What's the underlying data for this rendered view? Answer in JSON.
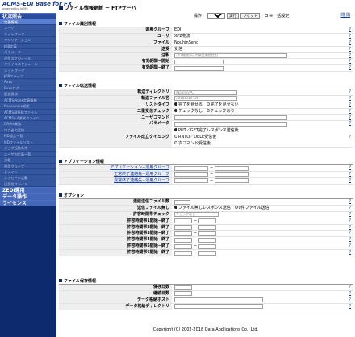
{
  "sidebar": {
    "logo_title": "ACMS-EDI Base for FX",
    "logo_sub": "powered by ACMS",
    "sections": [
      {
        "label": "状況照会",
        "items": [
          "定義情報",
          "ユーザ",
          "ネットワーク",
          "アプリケーション",
          "JOB定義",
          "パラメータ",
          "送信スケジュール",
          "ファイルスケジュール",
          "ネットワーク",
          "JOBステップ",
          "Rxxx",
          "Rxxxログ",
          "配信業務",
          "ACMS/Apex定義情報",
          "Naxxxxxxx設定",
          "ACMS/B業務ファイル",
          "ACMS/LA業務ファイル",
          "DR/Ax業務",
          "ログ出力変換",
          "MD設定一覧",
          "MDファイルリスト",
          "ジョブ起動条件",
          "ユーザ別定義一覧",
          "分類",
          "運用グループ",
          "ドメイン",
          "メッセージ定義",
          "送受信ファイル"
        ]
      },
      {
        "label": "ZEDI運用",
        "items": []
      },
      {
        "label": "データ操作",
        "items": []
      },
      {
        "label": "ライセンス",
        "items": []
      }
    ]
  },
  "header": {
    "title": "ファイル情報更新 － FTPサーバ",
    "help": "閉 閉",
    "op_label": "操作：",
    "op_select": "",
    "exec_button": "実行",
    "reset_button": "リセット",
    "no_display_label": "※一括設定"
  },
  "file_id": {
    "heading": "ファイル識別情報",
    "rows": [
      {
        "label": "運用グループ",
        "value": "EDI"
      },
      {
        "label": "ユーザ",
        "value": "XYZ物流"
      },
      {
        "label": "ファイル",
        "value": "NouhinSend"
      },
      {
        "label": "送受",
        "value": "受信"
      },
      {
        "label": "注釈",
        "value": "XYZ物流からの納品書受信用"
      },
      {
        "label": "有効期間−開始",
        "value": ""
      },
      {
        "label": "有効期間−終了",
        "value": ""
      }
    ]
  },
  "transfer": {
    "heading": "ファイル転送情報",
    "dir_label": "転送ディレクトリ",
    "dir_value": "/Nouhin/PC",
    "name_label": "転送ファイル名",
    "name_value": "20181116.txt",
    "list_label": "リストタイプ",
    "list_opt1": "完了を見せる",
    "list_opt2": "完了を見せない",
    "dup_label": "二重受信チェック",
    "dup_opt1": "チェックなし",
    "dup_opt2": "チェックあり",
    "usercmd_label": "ユーザコマンド",
    "param_label": "パラメータ",
    "timing_label": "ファイル成立タイミング",
    "timing_opt1": "PUT／GET完了レスポンス送信後",
    "timing_opt2": "RNTO／DELE受信後",
    "timing_opt3": "次コマンド受信後"
  },
  "app": {
    "heading": "アプリケーション情報",
    "rows": [
      {
        "label": "アプリケーション−運用グループ"
      },
      {
        "label": "正常終了連絡先−運用グループ"
      },
      {
        "label": "異常終了連絡先−運用グループ"
      }
    ]
  },
  "option": {
    "heading": "オプション",
    "count_label": "連結送信ファイル数",
    "send_label": "送信ファイル無し",
    "send_opt1": "ファイル無しレスポンス送信",
    "send_opt2": "0件ファイル送信",
    "check_label": "許容時間帯チェック",
    "check_value": "チェックなし",
    "time_rows": [
      "許容時間帯1開始−終了",
      "許容時間帯2開始−終了",
      "許容時間帯3開始−終了",
      "許容時間帯4開始−終了",
      "許容時間帯5開始−終了",
      "許容時間帯6開始−終了"
    ]
  },
  "storage": {
    "heading": "ファイル保存情報",
    "rows": [
      "保存日数",
      "継続日数",
      "データ格納ホスト",
      "データ格納ディレクトリ"
    ]
  },
  "help_mark": "?",
  "footer": "Copyright (C) 2002-2018 Data Applications Co., Ltd."
}
